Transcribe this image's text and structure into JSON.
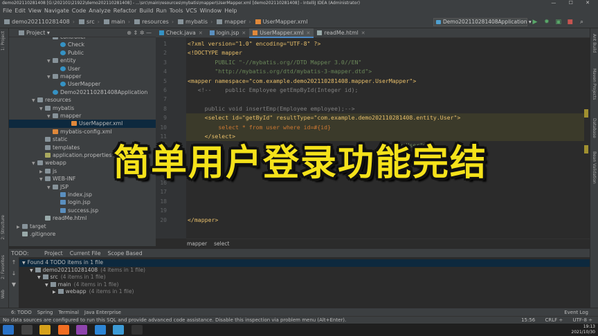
{
  "window": {
    "title": "demo202110281408 [G:\\202101\\21922\\demo202110281408] - ...\\src\\main\\resources\\mybatis\\mapper\\UserMapper.xml [demo202110281408] - IntelliJ IDEA (Administrator)",
    "controls": "— ☐ ✕"
  },
  "menu": [
    "File",
    "Edit",
    "View",
    "Navigate",
    "Code",
    "Analyze",
    "Refactor",
    "Build",
    "Run",
    "Tools",
    "VCS",
    "Window",
    "Help"
  ],
  "breadcrumbs": [
    "demo202110281408",
    "src",
    "main",
    "resources",
    "mybatis",
    "mapper",
    "UserMapper.xml"
  ],
  "run_config": "Demo202110281408Application",
  "run_icons": {
    "build": "⚒",
    "run": "▶",
    "debug": "✹",
    "coverage": "▣",
    "stop": "■",
    "search": "🔍"
  },
  "left_strip": {
    "project": "1: Project",
    "structure": "2: Structure",
    "favorites": "2: Favorites",
    "web": "Web"
  },
  "right_strip": {
    "ant": "Ant Build",
    "maven": "Maven Projects",
    "database": "Database",
    "bean": "Bean Validation"
  },
  "project_panel": {
    "title": "Project",
    "dropdown": "▾",
    "icons": "⊕ ⇕ ✲ —"
  },
  "tree": [
    {
      "label": "controller",
      "kind": "fold",
      "depth": 5,
      "arrow": ""
    },
    {
      "label": "Check",
      "kind": "cls",
      "depth": 6,
      "arrow": ""
    },
    {
      "label": "Public",
      "kind": "cls",
      "depth": 6,
      "arrow": ""
    },
    {
      "label": "entity",
      "kind": "fold",
      "depth": 5,
      "arrow": "▼"
    },
    {
      "label": "User",
      "kind": "cls",
      "depth": 6,
      "arrow": ""
    },
    {
      "label": "mapper",
      "kind": "fold",
      "depth": 5,
      "arrow": "▼"
    },
    {
      "label": "UserMapper",
      "kind": "cls",
      "depth": 6,
      "arrow": ""
    },
    {
      "label": "Demo202110281408Application",
      "kind": "cls",
      "depth": 5,
      "arrow": ""
    },
    {
      "label": "resources",
      "kind": "fold",
      "depth": 3,
      "arrow": "▼"
    },
    {
      "label": "mybatis",
      "kind": "fold",
      "depth": 4,
      "arrow": "▼"
    },
    {
      "label": "mapper",
      "kind": "fold",
      "depth": 5,
      "arrow": "▼"
    },
    {
      "label": "UserMapper.xml",
      "kind": "xmlic",
      "depth": 6,
      "arrow": "",
      "selected": true
    },
    {
      "label": "mybatis-config.xml",
      "kind": "xmlic",
      "depth": 5,
      "arrow": ""
    },
    {
      "label": "static",
      "kind": "fold",
      "depth": 4,
      "arrow": ""
    },
    {
      "label": "templates",
      "kind": "fold",
      "depth": 4,
      "arrow": ""
    },
    {
      "label": "application.properties",
      "kind": "propic",
      "depth": 4,
      "arrow": ""
    },
    {
      "label": "webapp",
      "kind": "fold",
      "depth": 3,
      "arrow": "▼"
    },
    {
      "label": "js",
      "kind": "fold",
      "depth": 4,
      "arrow": "▶"
    },
    {
      "label": "WEB-INF",
      "kind": "fold",
      "depth": 4,
      "arrow": "▼"
    },
    {
      "label": "JSP",
      "kind": "fold",
      "depth": 5,
      "arrow": "▼"
    },
    {
      "label": "index.jsp",
      "kind": "jspic",
      "depth": 6,
      "arrow": ""
    },
    {
      "label": "login.jsp",
      "kind": "jspic",
      "depth": 6,
      "arrow": ""
    },
    {
      "label": "success.jsp",
      "kind": "jspic",
      "depth": 6,
      "arrow": ""
    },
    {
      "label": "readMe.html",
      "kind": "txtic",
      "depth": 4,
      "arrow": ""
    },
    {
      "label": "target",
      "kind": "fold",
      "depth": 1,
      "arrow": "▶"
    },
    {
      "label": ".gitignore",
      "kind": "txtic",
      "depth": 1,
      "arrow": ""
    }
  ],
  "tabs": [
    {
      "label": "Check.java",
      "active": false,
      "color": "#3592c4"
    },
    {
      "label": "login.jsp",
      "active": false,
      "color": "#5a8fbf"
    },
    {
      "label": "UserMapper.xml",
      "active": true,
      "color": "#e0883a"
    },
    {
      "label": "readMe.html",
      "active": false,
      "color": "#9aa"
    }
  ],
  "code": [
    {
      "n": "1",
      "t": "<?xml version=\"1.0\" encoding=\"UTF-8\" ?>",
      "c": "c-tag"
    },
    {
      "n": "2",
      "t": "<!DOCTYPE mapper",
      "c": "c-tag"
    },
    {
      "n": "3",
      "t": "        PUBLIC \"-//mybatis.org//DTD Mapper 3.0//EN\"",
      "c": "c-str"
    },
    {
      "n": "4",
      "t": "        \"http://mybatis.org/dtd/mybatis-3-mapper.dtd\">",
      "c": "c-str"
    },
    {
      "n": "5",
      "t": "<mapper namespace=\"com.example.demo202110281408.mapper.UserMapper\">",
      "c": "c-tag"
    },
    {
      "n": "6",
      "t": "   <!--    public Employee getEmpById(Integer id);",
      "c": "c-cmt"
    },
    {
      "n": "7",
      "t": "",
      "c": "c-cmt"
    },
    {
      "n": "8",
      "t": "     public void insertEmp(Employee employee);-->",
      "c": "c-cmt"
    },
    {
      "n": "9",
      "t": "     <select id=\"getById\" resultType=\"com.example.demo202110281408.entity.User\">",
      "c": "c-tag",
      "hl": true
    },
    {
      "n": "10",
      "t": "         select * from user where id=#{id}",
      "c": "c-kw",
      "hl": true
    },
    {
      "n": "11",
      "t": "     </select>",
      "c": "c-tag",
      "hl": true
    },
    {
      "n": "12",
      "t": "                                                         entity.User\">",
      "c": "c-str"
    },
    {
      "n": "13",
      "t": "",
      "c": ""
    },
    {
      "n": "14",
      "t": "",
      "c": ""
    },
    {
      "n": "15",
      "t": "",
      "c": ""
    },
    {
      "n": "16",
      "t": "",
      "c": ""
    },
    {
      "n": "17",
      "t": "",
      "c": ""
    },
    {
      "n": "18",
      "t": "",
      "c": ""
    },
    {
      "n": "19",
      "t": "",
      "c": ""
    },
    {
      "n": "20",
      "t": "</mapper>",
      "c": "c-tag"
    }
  ],
  "code_breadcrumb": [
    "mapper",
    "select"
  ],
  "todo": {
    "title": "TODO:",
    "tabs": [
      "Project",
      "Current File",
      "Scope Based"
    ],
    "rows": [
      {
        "label": "Found 4 TODO items in 1 file",
        "count": "",
        "depth": 0,
        "arrow": "▼"
      },
      {
        "label": "demo202110281408",
        "count": "(4 items in 1 file)",
        "depth": 1,
        "arrow": "▼"
      },
      {
        "label": "src",
        "count": "(4 items in 1 file)",
        "depth": 2,
        "arrow": "▼"
      },
      {
        "label": "main",
        "count": "(4 items in 1 file)",
        "depth": 3,
        "arrow": "▼"
      },
      {
        "label": "webapp",
        "count": "(4 items in 1 file)",
        "depth": 4,
        "arrow": "▶"
      }
    ],
    "side_icons": [
      "↑",
      "↓",
      "▼"
    ]
  },
  "tool_windows": [
    "6: TODO",
    "Spring",
    "Terminal",
    "Java Enterprise"
  ],
  "event_log": "Event Log",
  "status": {
    "message": "No data sources are configured to run this SQL and provide advanced code assistance. Disable this inspection via problem menu (Alt+Enter).",
    "position": "15:56",
    "line_sep": "CRLF ÷",
    "encoding": "UTF-8 ÷"
  },
  "overlay_text": "简单用户登录功能完结",
  "clock": {
    "time": "19:13",
    "date": "2021/10/30"
  }
}
